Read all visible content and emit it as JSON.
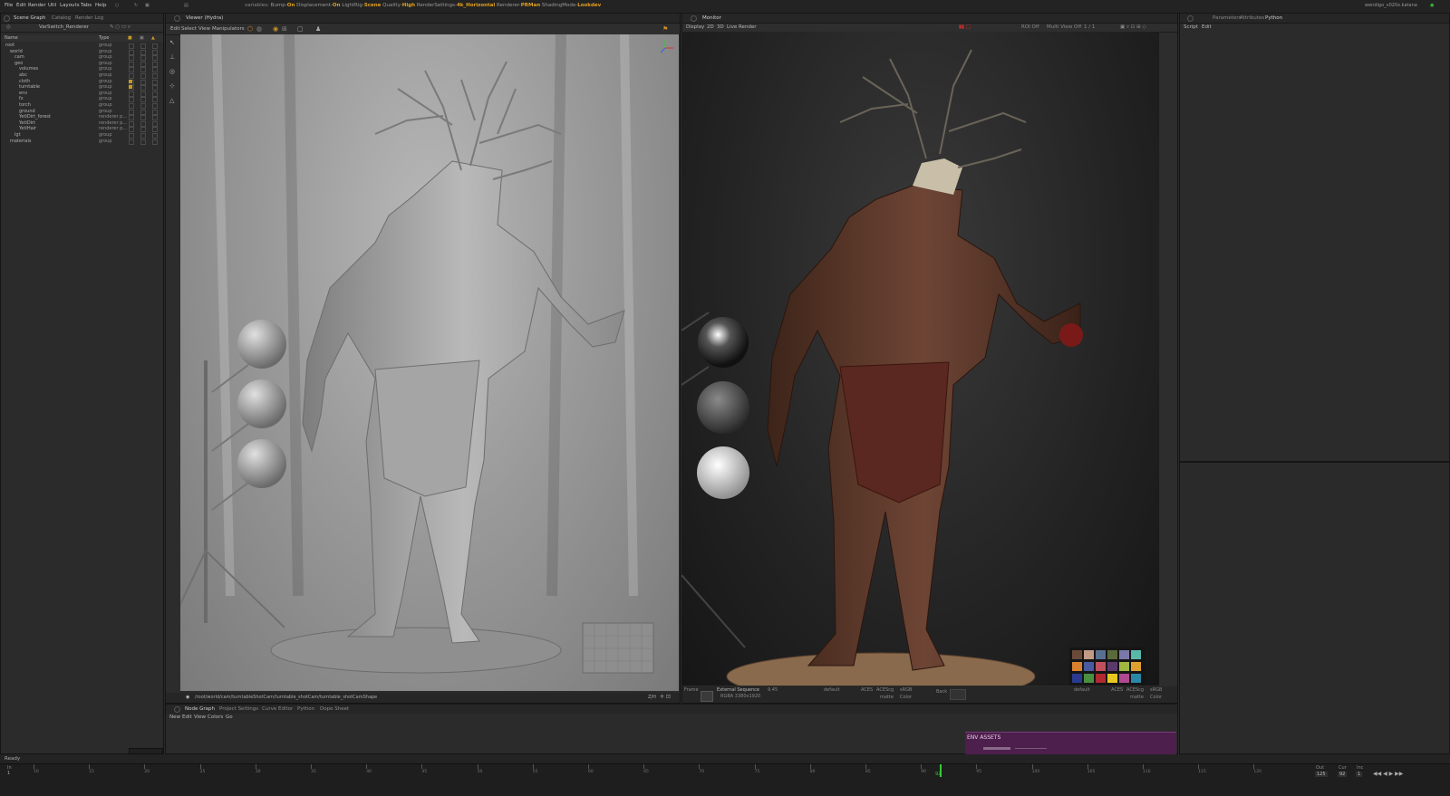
{
  "menubar": {
    "items": [
      "File",
      "Edit",
      "Render",
      "Util",
      "Layouts",
      "Tabs",
      "Help"
    ],
    "render_info": {
      "prefix": "variables:",
      "bump_label": "Bump-",
      "bump_value": "On",
      "displacement_label": "Displacement-",
      "displacement_value": "On",
      "lightrig_label": "LightRig-",
      "lightrig_value": "Scene",
      "quality_label": "Quality-",
      "quality_value": "High",
      "rendersettings_label": "RenderSettings-",
      "rendersettings_value": "4k_Horizontal",
      "renderer_label": "Renderer-",
      "renderer_value": "PRMan",
      "shading_label": "ShadingMode-",
      "shading_value": "Lookdev"
    },
    "project_file": "wendigo_v020x.katana"
  },
  "scene_graph": {
    "tabs": [
      "Scene Graph",
      "Catalog",
      "Render Log"
    ],
    "renderer_name": "VarSwitch_Renderer",
    "columns": {
      "name": "Name",
      "type": "Type"
    },
    "rows": [
      {
        "name": "root",
        "type": "group",
        "depth": 0,
        "lock": false
      },
      {
        "name": "world",
        "type": "group",
        "depth": 1,
        "lock": false
      },
      {
        "name": "cam",
        "type": "group",
        "depth": 2,
        "lock": false
      },
      {
        "name": "geo",
        "type": "group",
        "depth": 2,
        "lock": false
      },
      {
        "name": "volumes",
        "type": "group",
        "depth": 3,
        "lock": false
      },
      {
        "name": "abc",
        "type": "group",
        "depth": 3,
        "lock": false
      },
      {
        "name": "cloth",
        "type": "group",
        "depth": 3,
        "lock": true
      },
      {
        "name": "turntable",
        "type": "group",
        "depth": 3,
        "lock": true
      },
      {
        "name": "env",
        "type": "group",
        "depth": 3,
        "lock": false
      },
      {
        "name": "fx",
        "type": "group",
        "depth": 3,
        "lock": false
      },
      {
        "name": "torch",
        "type": "group",
        "depth": 3,
        "lock": false
      },
      {
        "name": "ground",
        "type": "group",
        "depth": 3,
        "lock": false
      },
      {
        "name": "YetiDirt_forest",
        "type": "renderer p...",
        "depth": 3,
        "lock": false
      },
      {
        "name": "YetiDirt",
        "type": "renderer p...",
        "depth": 3,
        "lock": false
      },
      {
        "name": "YetiHair",
        "type": "renderer p...",
        "depth": 3,
        "lock": false
      },
      {
        "name": "lgt",
        "type": "group",
        "depth": 2,
        "lock": false
      },
      {
        "name": "materials",
        "type": "group",
        "depth": 1,
        "lock": false
      }
    ]
  },
  "viewer": {
    "tab": "Viewer (Hydra)",
    "menu": [
      "Edit",
      "Select",
      "View",
      "Manipulators"
    ],
    "camera_path": "/root/world/cam/turntableShotCam/turntable_shotCam/turntable_shotCamShape",
    "aspect": "Z/H"
  },
  "monitor": {
    "tab": "Monitor",
    "menu": [
      "Display",
      "2D",
      "3D",
      "Live Render"
    ],
    "roi": "ROI Off",
    "multiview": "Multi View Off",
    "page": "1 / 1",
    "footer": {
      "frame_label": "Frame",
      "source": "External Sequence",
      "frame_value": "9.45",
      "format": "RGBA 3380x1920",
      "left_lut": "default",
      "cs1": "ACES",
      "cs2": "ACEScg",
      "cs3": "sRGB",
      "matte": "matte",
      "color": "Color",
      "back": "Back",
      "right_lut": "default"
    }
  },
  "right_panel": {
    "tabs": [
      "Parameters",
      "Attributes",
      "Python"
    ],
    "menu": [
      "Script",
      "Edit"
    ]
  },
  "bottom_panel": {
    "tabs": [
      "Node Graph",
      "Project Settings",
      "Curve Editor",
      "Python",
      "Dope Sheet"
    ],
    "menu": [
      "New",
      "Edit",
      "View",
      "Colors",
      "Go"
    ],
    "backdrop_label": "ENV ASSETS"
  },
  "status": "Ready",
  "timeline": {
    "ticks": [
      "10",
      "15",
      "20",
      "25",
      "30",
      "35",
      "40",
      "45",
      "50",
      "55",
      "60",
      "65",
      "70",
      "75",
      "80",
      "85",
      "90",
      "95",
      "100",
      "105",
      "110",
      "115",
      "120"
    ],
    "current_frame": "92",
    "in_label": "In",
    "in_value": "1",
    "out_label": "Out",
    "out_value": "125",
    "cur_label": "Cur",
    "cur_value": "92",
    "inc_label": "Inc",
    "inc_value": "1"
  },
  "colors": {
    "accent": "#e0a020",
    "backdrop": "#4d1f4c"
  }
}
